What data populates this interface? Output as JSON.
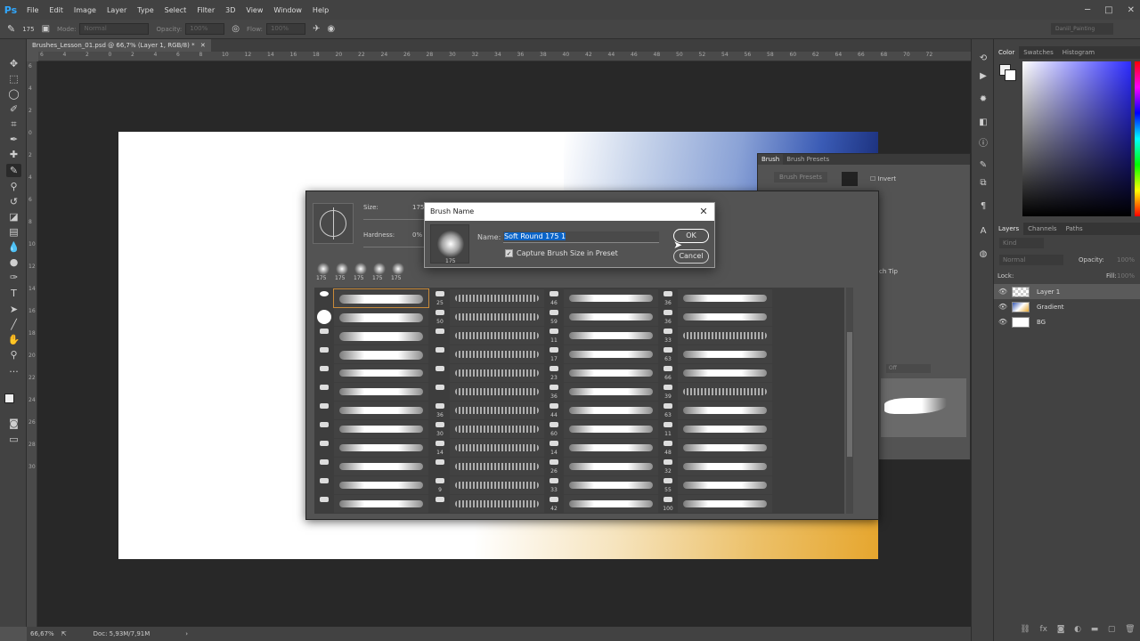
{
  "app": {
    "logo": "Ps",
    "menu": [
      "File",
      "Edit",
      "Image",
      "Layer",
      "Type",
      "Select",
      "Filter",
      "3D",
      "View",
      "Window",
      "Help"
    ]
  },
  "options": {
    "brush_size": "175",
    "mode_label": "Mode:",
    "mode_value": "Normal",
    "opacity_label": "Opacity:",
    "opacity_value": "100%",
    "flow_label": "Flow:",
    "flow_value": "100%",
    "workspace": "Daniil_Painting"
  },
  "document": {
    "tab_title": "Brushes_Lesson_01.psd @ 66,7% (Layer 1, RGB/8) *",
    "ruler_top": [
      "6",
      "4",
      "2",
      "0",
      "2",
      "4",
      "6",
      "8",
      "10",
      "12",
      "14",
      "16",
      "18",
      "20",
      "22",
      "24",
      "26",
      "28",
      "30",
      "32",
      "34",
      "36",
      "38",
      "40",
      "42",
      "44",
      "46",
      "48",
      "50",
      "52",
      "54",
      "56",
      "58",
      "60",
      "62",
      "64",
      "66",
      "68",
      "70",
      "72"
    ],
    "ruler_left": [
      "6",
      "4",
      "2",
      "0",
      "2",
      "4",
      "6",
      "8",
      "10",
      "12",
      "14",
      "16",
      "18",
      "20",
      "22",
      "24",
      "26",
      "28",
      "30"
    ]
  },
  "status": {
    "zoom": "66,67%",
    "doc": "Doc: 5,93M/7,91M"
  },
  "right_panel": {
    "color_tabs": [
      "Color",
      "Swatches",
      "Histogram"
    ],
    "layers_tabs": [
      "Layers",
      "Channels",
      "Paths"
    ],
    "kind_placeholder": "Kind",
    "blend": "Normal",
    "opacity_label": "Opacity:",
    "opacity_value": "100%",
    "lock_label": "Lock:",
    "fill_label": "Fill:",
    "fill_value": "100%",
    "layers": [
      {
        "name": "Layer 1"
      },
      {
        "name": "Gradient"
      },
      {
        "name": "BG"
      }
    ]
  },
  "brush_panel": {
    "tabs": [
      "Brush",
      "Brush Presets"
    ],
    "presets_btn": "Brush Presets",
    "invert": "Invert",
    "tip_label": "ch Tip",
    "off": "Off"
  },
  "preset_picker": {
    "size_label": "Size:",
    "size_value": "175",
    "hardness_label": "Hardness:",
    "hardness_value": "0%",
    "recent": [
      "175",
      "175",
      "175",
      "175",
      "175"
    ]
  },
  "dialog": {
    "title": "Brush Name",
    "name_label": "Name:",
    "name_value": "Soft Round 175 1",
    "preview_size": "175",
    "checkbox_label": "Capture Brush Size in Preset",
    "ok": "OK",
    "cancel": "Cancel"
  },
  "brush_cols": [
    {
      "sizes": [
        "",
        "",
        "",
        "",
        "",
        "",
        "",
        "",
        "",
        "",
        "",
        ""
      ]
    },
    {
      "sizes": [
        "25",
        "50",
        "",
        "",
        "",
        "",
        "36",
        "30",
        "14",
        "",
        "9",
        ""
      ]
    },
    {
      "sizes": [
        "46",
        "59",
        "11",
        "17",
        "23",
        "36",
        "44",
        "60",
        "14",
        "26",
        "33",
        "42"
      ]
    },
    {
      "sizes": [
        "36",
        "36",
        "33",
        "63",
        "66",
        "39",
        "63",
        "11",
        "48",
        "32",
        "55",
        "100"
      ]
    }
  ]
}
